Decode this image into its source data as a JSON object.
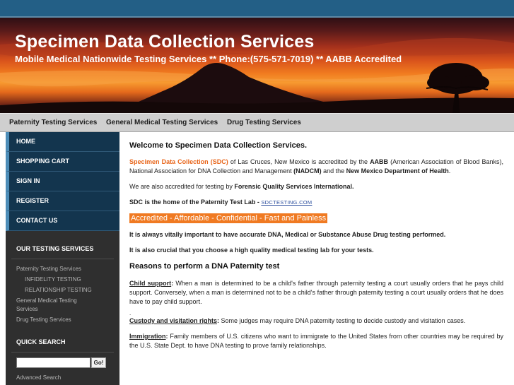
{
  "site": {
    "title": "Specimen Data Collection Services",
    "subtitle": "Mobile Medical Nationwide Testing Services ** Phone:(575-571-7019) ** AABB Accredited"
  },
  "nav": {
    "items": [
      "Paternity Testing Services",
      "General Medical Testing Services",
      "Drug Testing Services"
    ]
  },
  "sidebar": {
    "menu": [
      "HOME",
      "SHOPPING CART",
      "SIGN IN",
      "REGISTER",
      "CONTACT US"
    ],
    "services_heading": "OUR TESTING SERVICES",
    "services": {
      "paternity": "Paternity Testing Services",
      "infidelity": "INFIDELITY TESTING",
      "relationship": "RELATIONSHIP TESTING",
      "general_1": "General Medical Testing",
      "general_2": "Services",
      "drug": "Drug Testing Services"
    },
    "quick_search_heading": "QUICK SEARCH",
    "search_value": "",
    "search_button": "Go!",
    "advanced_search": "Advanced Search"
  },
  "content": {
    "welcome": "Welcome to Specimen Data Collection Services.",
    "p1": {
      "sdc": "Specimen Data Collection (SDC)",
      "t1": " of Las Cruces, New Mexico is accredited by the ",
      "aabb": "AABB",
      "t2": " (American Association of Blood Banks), National Association for DNA Collection and Management ",
      "nadcm": "(NADCM)",
      "t3": " and the ",
      "nmdoh": "New Mexico Department of Health",
      "t4": "."
    },
    "p2": {
      "t1": "We are also accredited for testing by ",
      "fqs": "Forensic Quality Services International."
    },
    "p3": {
      "t1": "SDC is the home of the Paternity Test Lab - ",
      "link": "SDCTESTING.COM"
    },
    "highlight": "Accredited - Affordable - Confidential - Fast and Painless",
    "important": "It is always vitally important to have accurate DNA, Medical or Substance Abuse Drug testing performed.",
    "crucial": "It is also crucial that you choose a high quality medical testing lab for your tests.",
    "reasons_heading": "Reasons to perform a DNA Paternity test",
    "child_support": {
      "label": "Child support",
      "colon": ":",
      "text": " When a man is determined to be a child's father through paternity testing a court usually orders that he pays child support. Conversely, when a man is determined not to be a child's father through paternity testing a court usually orders that he does have to pay child support."
    },
    "stray_dot": ".",
    "custody": {
      "label": "Custody and visitation rights",
      "colon": ":",
      "text": " Some judges may require DNA paternity testing to decide custody and visitation cases."
    },
    "immigration": {
      "label": "Immigration",
      "colon": ":",
      "text": " Family members of U.S. citizens who want to immigrate to the United States from other countries may be required by the U.S. State Dept. to have DNA testing to prove family relationships."
    }
  },
  "colors": {
    "topbar": "#235f86",
    "menu_bg": "#13354e",
    "accent_orange": "#e8651a",
    "sidebar_bg": "#2f2f2f"
  }
}
